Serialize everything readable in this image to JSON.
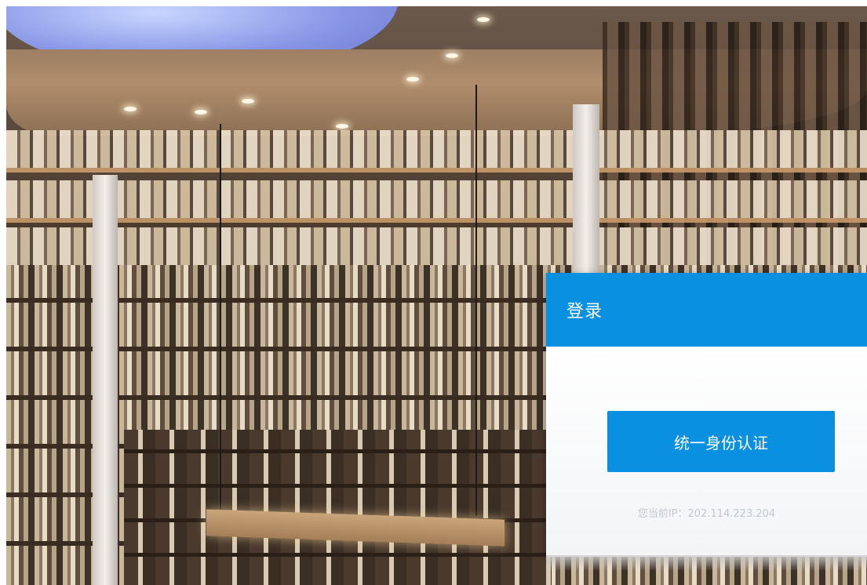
{
  "login": {
    "title": "登录",
    "auth_button_label": "统一身份认证",
    "ip_label": "您当前IP：",
    "ip_value": "202.114.223.204"
  },
  "colors": {
    "accent": "#0a90e0",
    "header_text": "#ffffff",
    "ip_text": "#c4c9ce"
  }
}
